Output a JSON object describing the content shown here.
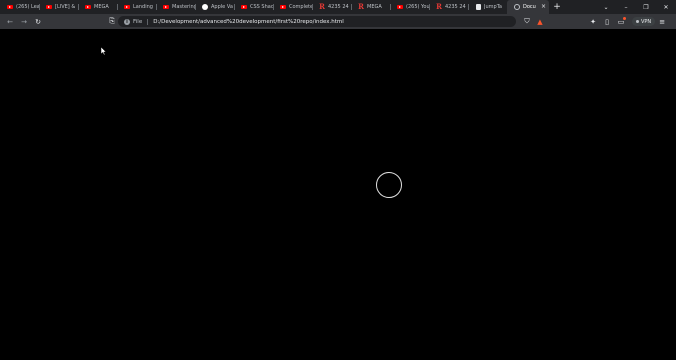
{
  "tabs": [
    {
      "title": "(265) Lea",
      "icon": "youtube-icon",
      "active": false
    },
    {
      "title": "[LIVE] & ",
      "icon": "youtube-icon",
      "active": false
    },
    {
      "title": "MEGA",
      "icon": "youtube-icon",
      "active": false
    },
    {
      "title": "Landing",
      "icon": "youtube-icon",
      "active": false
    },
    {
      "title": "Mastering",
      "icon": "youtube-icon",
      "active": false
    },
    {
      "title": "Apple Va",
      "icon": "github-icon",
      "active": false
    },
    {
      "title": "CSS Shad",
      "icon": "youtube-icon",
      "active": false
    },
    {
      "title": "Complete",
      "icon": "youtube-icon",
      "active": false
    },
    {
      "title": "4235 24",
      "icon": "r-icon",
      "active": false
    },
    {
      "title": "MEGA",
      "icon": "r-icon",
      "active": false
    },
    {
      "title": "(265) You",
      "icon": "youtube-icon",
      "active": false
    },
    {
      "title": "4235 24",
      "icon": "r-icon",
      "active": false
    },
    {
      "title": "JumpTa",
      "icon": "document-icon",
      "active": false
    },
    {
      "title": "Docu",
      "icon": "globe-icon",
      "active": true
    }
  ],
  "toolbar": {
    "scheme": "File",
    "url": "D:/Development/advanced%20development/first%20repo/index.html",
    "vpn_label": "VPN"
  },
  "glyphs": {
    "new_tab": "+",
    "tab_list": "⌄",
    "close": "×",
    "minimize": "–",
    "maximize": "❐",
    "window_close": "✕",
    "back": "←",
    "forward": "→",
    "reload": "↻",
    "bookmark": "⎘",
    "shield": "⛉",
    "rewards": "▲",
    "extensions": "✦",
    "sidebar": "▯",
    "wallet": "▭",
    "menu": "≡",
    "info": "i"
  },
  "colors": {
    "tabstrip_bg": "#202124",
    "toolbar_bg": "#35363a",
    "page_bg": "#000000",
    "youtube_red": "#ff0000",
    "brave_orange": "#fb542b"
  }
}
